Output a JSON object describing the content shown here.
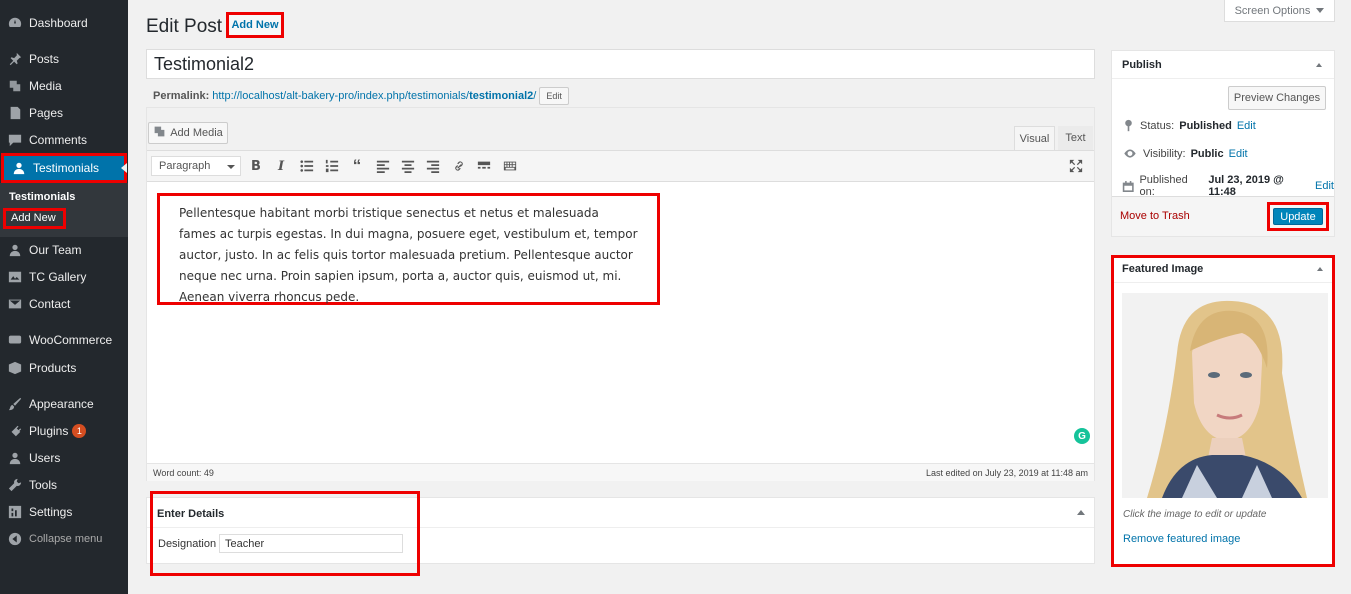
{
  "sidebar": {
    "items": [
      {
        "name": "dashboard",
        "label": "Dashboard",
        "icon": "dashboard-icon"
      },
      {
        "name": "posts",
        "label": "Posts",
        "icon": "pin-icon"
      },
      {
        "name": "media",
        "label": "Media",
        "icon": "media-icon"
      },
      {
        "name": "pages",
        "label": "Pages",
        "icon": "page-icon"
      },
      {
        "name": "comments",
        "label": "Comments",
        "icon": "comment-icon"
      },
      {
        "name": "testimonials",
        "label": "Testimonials",
        "icon": "user-icon"
      },
      {
        "name": "our-team",
        "label": "Our Team",
        "icon": "user-icon"
      },
      {
        "name": "tc-gallery",
        "label": "TC Gallery",
        "icon": "gallery-icon"
      },
      {
        "name": "contact",
        "label": "Contact",
        "icon": "mail-icon"
      },
      {
        "name": "woocommerce",
        "label": "WooCommerce",
        "icon": "woo-icon"
      },
      {
        "name": "products",
        "label": "Products",
        "icon": "box-icon"
      },
      {
        "name": "appearance",
        "label": "Appearance",
        "icon": "brush-icon"
      },
      {
        "name": "plugins",
        "label": "Plugins",
        "icon": "plug-icon",
        "badge": "1"
      },
      {
        "name": "users",
        "label": "Users",
        "icon": "user-icon"
      },
      {
        "name": "tools",
        "label": "Tools",
        "icon": "wrench-icon"
      },
      {
        "name": "settings",
        "label": "Settings",
        "icon": "settings-icon"
      }
    ],
    "submenu": {
      "head": "Testimonials",
      "add_new": "Add New"
    },
    "collapse_label": "Collapse menu"
  },
  "header": {
    "title": "Edit Post",
    "add_new_label": "Add New",
    "screen_options_label": "Screen Options"
  },
  "post": {
    "title": "Testimonial2",
    "permalink_label": "Permalink:",
    "permalink_base": "http://localhost/alt-bakery-pro/index.php/testimonials/",
    "permalink_slug": "testimonial2",
    "permalink_trail": "/",
    "permalink_edit_label": "Edit"
  },
  "editor": {
    "add_media_label": "Add Media",
    "tab_visual": "Visual",
    "tab_text": "Text",
    "format_value": "Paragraph",
    "content": "Pellentesque habitant morbi tristique senectus et netus et malesuada fames ac turpis egestas. In dui magna, posuere eget, vestibulum et, tempor auctor, justo. In ac felis quis tortor malesuada pretium. Pellentesque auctor neque nec urna. Proin sapien ipsum, porta a, auctor quis, euismod ut, mi. Aenean viverra rhoncus pede.",
    "word_count": "Word count: 49",
    "last_edited": "Last edited on July 23, 2019 at 11:48 am",
    "grammarly_glyph": "G"
  },
  "details": {
    "title": "Enter Details",
    "designation_label": "Designation",
    "designation_value": "Teacher"
  },
  "publish": {
    "title": "Publish",
    "preview_label": "Preview Changes",
    "status_label": "Status:",
    "status_value": "Published",
    "visibility_label": "Visibility:",
    "visibility_value": "Public",
    "published_label": "Published on:",
    "published_value": "Jul 23, 2019 @ 11:48",
    "edit_label": "Edit",
    "trash_label": "Move to Trash",
    "update_label": "Update"
  },
  "featured": {
    "title": "Featured Image",
    "caption": "Click the image to edit or update",
    "remove_label": "Remove featured image"
  },
  "colors": {
    "sidebar_bg": "#23282d",
    "accent": "#0073aa",
    "highlight": "#ee0000",
    "update_button": "#0085ba"
  }
}
